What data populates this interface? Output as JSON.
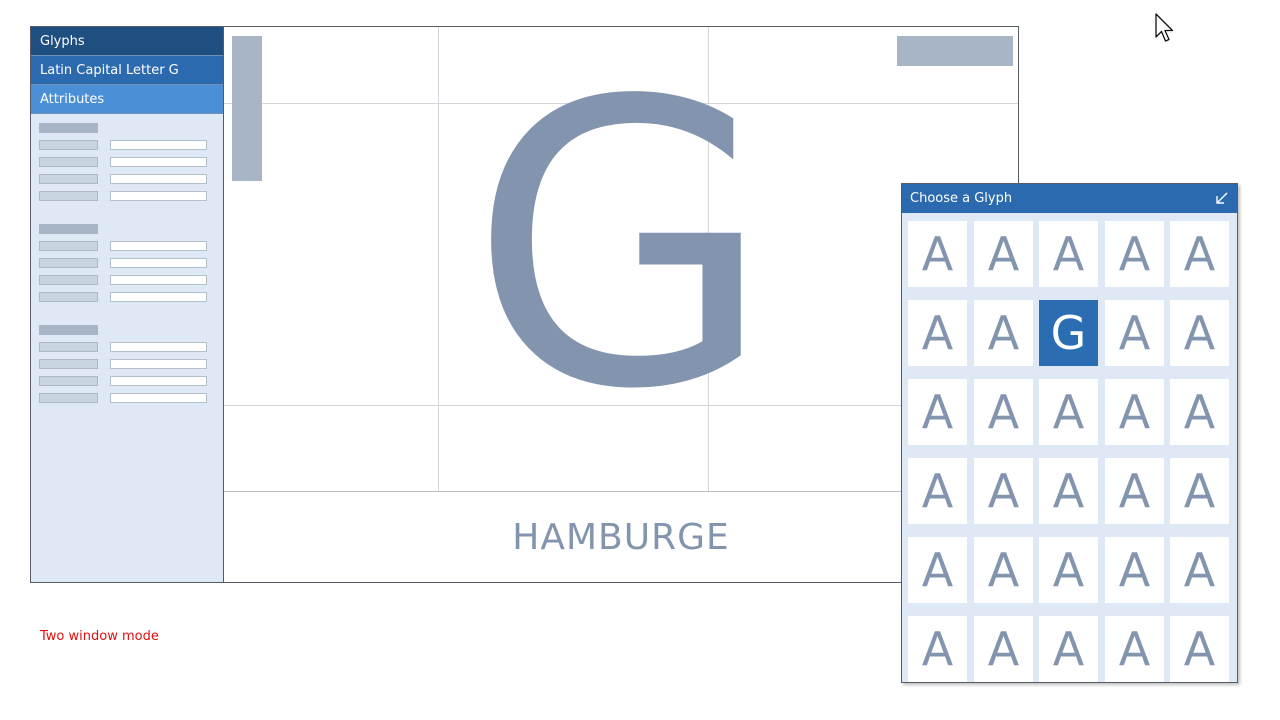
{
  "sidebar": {
    "glyphs_header": "Glyphs",
    "selected_glyph_name": "Latin Capital Letter G",
    "attributes_header": "Attributes",
    "attribute_groups": [
      {
        "rows": 4
      },
      {
        "rows": 4
      },
      {
        "rows": 4
      }
    ]
  },
  "canvas": {
    "glyph": "G",
    "preview_text": "HAMBURGE"
  },
  "mode_label": "Two window mode",
  "chooser": {
    "title": "Choose a Glyph",
    "collapse_icon": "collapse-arrow-icon",
    "glyphs": [
      "A",
      "A",
      "A",
      "A",
      "A",
      "A",
      "A",
      "G",
      "A",
      "A",
      "A",
      "A",
      "A",
      "A",
      "A",
      "A",
      "A",
      "A",
      "A",
      "A",
      "A",
      "A",
      "A",
      "A",
      "A",
      "A",
      "A",
      "A",
      "A",
      "A"
    ],
    "selected_index": 7
  },
  "colors": {
    "sidebar_dark": "#1f4e80",
    "sidebar_mid": "#2c6ab0",
    "sidebar_light": "#4b8fd6",
    "glyph_gray_blue": "#8395ae",
    "selected_cell": "#2a6db3",
    "mode_label": "#e01010"
  }
}
